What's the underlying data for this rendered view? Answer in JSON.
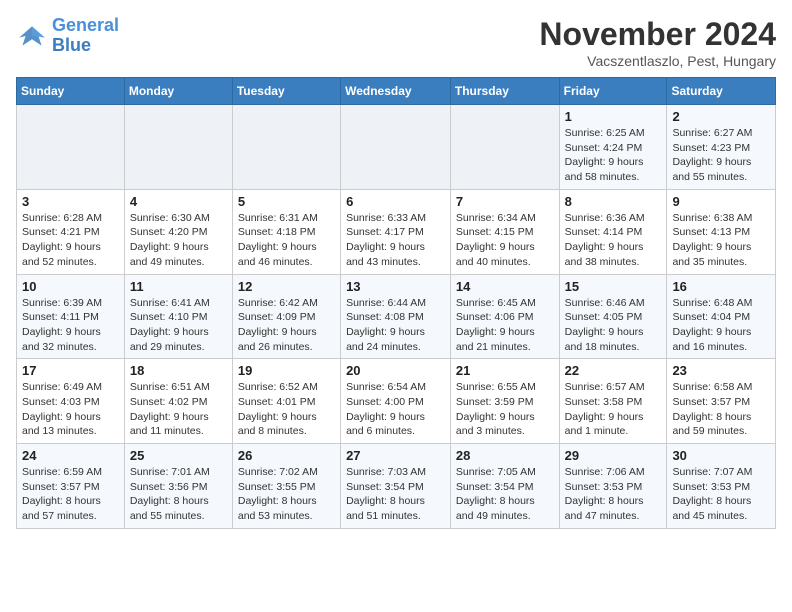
{
  "logo": {
    "line1": "General",
    "line2": "Blue"
  },
  "title": "November 2024",
  "subtitle": "Vacszentlaszlo, Pest, Hungary",
  "days_of_week": [
    "Sunday",
    "Monday",
    "Tuesday",
    "Wednesday",
    "Thursday",
    "Friday",
    "Saturday"
  ],
  "weeks": [
    [
      {
        "day": "",
        "info": ""
      },
      {
        "day": "",
        "info": ""
      },
      {
        "day": "",
        "info": ""
      },
      {
        "day": "",
        "info": ""
      },
      {
        "day": "",
        "info": ""
      },
      {
        "day": "1",
        "info": "Sunrise: 6:25 AM\nSunset: 4:24 PM\nDaylight: 9 hours and 58 minutes."
      },
      {
        "day": "2",
        "info": "Sunrise: 6:27 AM\nSunset: 4:23 PM\nDaylight: 9 hours and 55 minutes."
      }
    ],
    [
      {
        "day": "3",
        "info": "Sunrise: 6:28 AM\nSunset: 4:21 PM\nDaylight: 9 hours and 52 minutes."
      },
      {
        "day": "4",
        "info": "Sunrise: 6:30 AM\nSunset: 4:20 PM\nDaylight: 9 hours and 49 minutes."
      },
      {
        "day": "5",
        "info": "Sunrise: 6:31 AM\nSunset: 4:18 PM\nDaylight: 9 hours and 46 minutes."
      },
      {
        "day": "6",
        "info": "Sunrise: 6:33 AM\nSunset: 4:17 PM\nDaylight: 9 hours and 43 minutes."
      },
      {
        "day": "7",
        "info": "Sunrise: 6:34 AM\nSunset: 4:15 PM\nDaylight: 9 hours and 40 minutes."
      },
      {
        "day": "8",
        "info": "Sunrise: 6:36 AM\nSunset: 4:14 PM\nDaylight: 9 hours and 38 minutes."
      },
      {
        "day": "9",
        "info": "Sunrise: 6:38 AM\nSunset: 4:13 PM\nDaylight: 9 hours and 35 minutes."
      }
    ],
    [
      {
        "day": "10",
        "info": "Sunrise: 6:39 AM\nSunset: 4:11 PM\nDaylight: 9 hours and 32 minutes."
      },
      {
        "day": "11",
        "info": "Sunrise: 6:41 AM\nSunset: 4:10 PM\nDaylight: 9 hours and 29 minutes."
      },
      {
        "day": "12",
        "info": "Sunrise: 6:42 AM\nSunset: 4:09 PM\nDaylight: 9 hours and 26 minutes."
      },
      {
        "day": "13",
        "info": "Sunrise: 6:44 AM\nSunset: 4:08 PM\nDaylight: 9 hours and 24 minutes."
      },
      {
        "day": "14",
        "info": "Sunrise: 6:45 AM\nSunset: 4:06 PM\nDaylight: 9 hours and 21 minutes."
      },
      {
        "day": "15",
        "info": "Sunrise: 6:46 AM\nSunset: 4:05 PM\nDaylight: 9 hours and 18 minutes."
      },
      {
        "day": "16",
        "info": "Sunrise: 6:48 AM\nSunset: 4:04 PM\nDaylight: 9 hours and 16 minutes."
      }
    ],
    [
      {
        "day": "17",
        "info": "Sunrise: 6:49 AM\nSunset: 4:03 PM\nDaylight: 9 hours and 13 minutes."
      },
      {
        "day": "18",
        "info": "Sunrise: 6:51 AM\nSunset: 4:02 PM\nDaylight: 9 hours and 11 minutes."
      },
      {
        "day": "19",
        "info": "Sunrise: 6:52 AM\nSunset: 4:01 PM\nDaylight: 9 hours and 8 minutes."
      },
      {
        "day": "20",
        "info": "Sunrise: 6:54 AM\nSunset: 4:00 PM\nDaylight: 9 hours and 6 minutes."
      },
      {
        "day": "21",
        "info": "Sunrise: 6:55 AM\nSunset: 3:59 PM\nDaylight: 9 hours and 3 minutes."
      },
      {
        "day": "22",
        "info": "Sunrise: 6:57 AM\nSunset: 3:58 PM\nDaylight: 9 hours and 1 minute."
      },
      {
        "day": "23",
        "info": "Sunrise: 6:58 AM\nSunset: 3:57 PM\nDaylight: 8 hours and 59 minutes."
      }
    ],
    [
      {
        "day": "24",
        "info": "Sunrise: 6:59 AM\nSunset: 3:57 PM\nDaylight: 8 hours and 57 minutes."
      },
      {
        "day": "25",
        "info": "Sunrise: 7:01 AM\nSunset: 3:56 PM\nDaylight: 8 hours and 55 minutes."
      },
      {
        "day": "26",
        "info": "Sunrise: 7:02 AM\nSunset: 3:55 PM\nDaylight: 8 hours and 53 minutes."
      },
      {
        "day": "27",
        "info": "Sunrise: 7:03 AM\nSunset: 3:54 PM\nDaylight: 8 hours and 51 minutes."
      },
      {
        "day": "28",
        "info": "Sunrise: 7:05 AM\nSunset: 3:54 PM\nDaylight: 8 hours and 49 minutes."
      },
      {
        "day": "29",
        "info": "Sunrise: 7:06 AM\nSunset: 3:53 PM\nDaylight: 8 hours and 47 minutes."
      },
      {
        "day": "30",
        "info": "Sunrise: 7:07 AM\nSunset: 3:53 PM\nDaylight: 8 hours and 45 minutes."
      }
    ]
  ]
}
